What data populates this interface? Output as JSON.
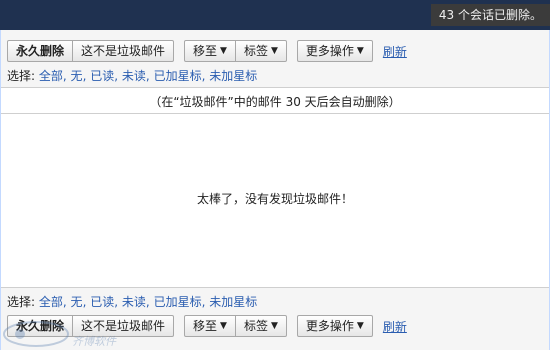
{
  "notification": {
    "text": "43 个会话已删除。"
  },
  "toolbar": {
    "delete_forever": "永久删除",
    "not_spam": "这不是垃圾邮件",
    "move_to": "移至",
    "labels": "标签",
    "more_actions": "更多操作",
    "refresh": "刷新",
    "dropdown_glyph": "▼"
  },
  "select": {
    "label": "选择:",
    "options": [
      "全部",
      "无",
      "已读",
      "未读",
      "已加星标",
      "未加星标"
    ],
    "separator": ","
  },
  "info": {
    "text": "（在“垃圾邮件”中的邮件 30 天后会自动删除）"
  },
  "empty": {
    "message": "太棒了，没有发现垃圾邮件！"
  },
  "watermark": {
    "text": "齐博软件"
  },
  "colors": {
    "top_bar": "#1f3150",
    "link": "#2a5db0",
    "toolbar_bg": "#f5f5f5"
  },
  "icons": {
    "dropdown": "chevron-down-icon",
    "watermark_logo": "logo-icon"
  }
}
